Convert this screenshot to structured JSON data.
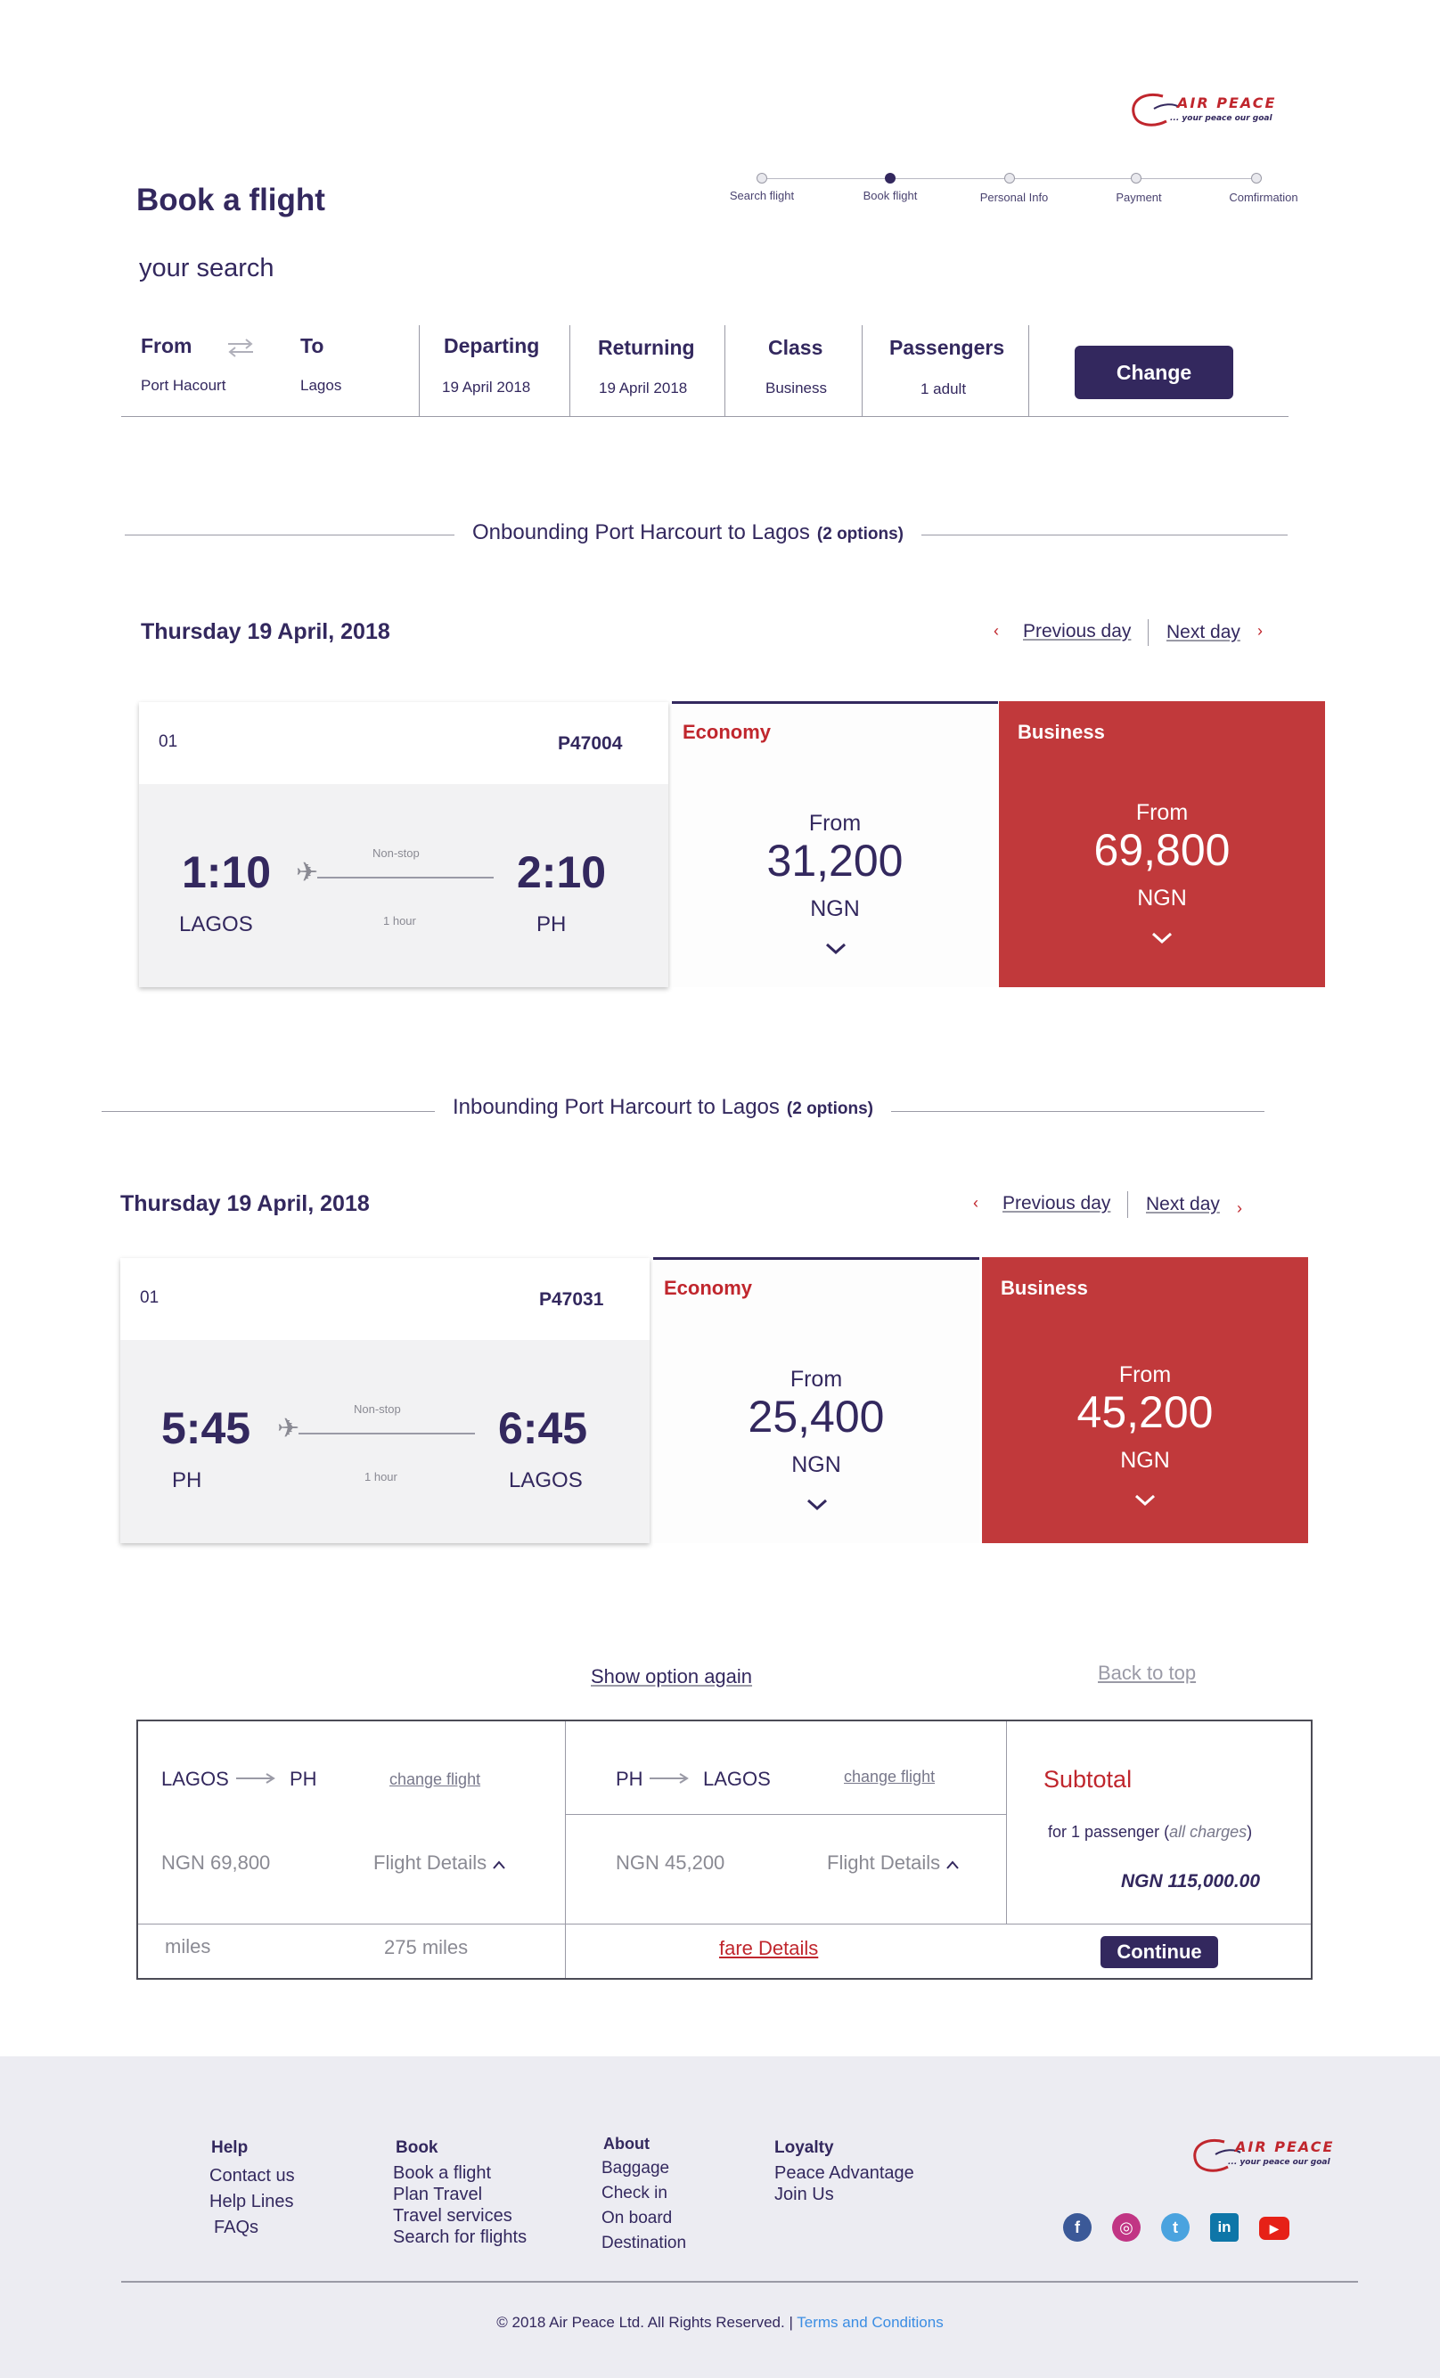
{
  "brand": {
    "name": "AIR PEACE",
    "tagline": "... your peace our goal"
  },
  "header": {
    "title": "Book a flight",
    "subtitle": "your search"
  },
  "stepper": {
    "steps": [
      "Search flight",
      "Book flight",
      "Personal Info",
      "Payment",
      "Comfirmation"
    ],
    "active_index": 1
  },
  "search": {
    "from_label": "From",
    "from_value": "Port Hacourt",
    "to_label": "To",
    "to_value": "Lagos",
    "departing_label": "Departing",
    "departing_value": "19 April 2018",
    "returning_label": "Returning",
    "returning_value": "19 April 2018",
    "class_label": "Class",
    "class_value": "Business",
    "passengers_label": "Passengers",
    "passengers_value": "1 adult",
    "change_label": "Change"
  },
  "onbound": {
    "heading": "Onbounding Port Harcourt to Lagos",
    "options": "(2 options)",
    "date": "Thursday 19 April, 2018",
    "prev_day": "Previous day",
    "next_day": "Next day",
    "flight": {
      "number": "01",
      "code": "P47004",
      "depart_time": "1:10",
      "depart_city": "LAGOS",
      "arrive_time": "2:10",
      "arrive_city": "PH",
      "stops": "Non-stop",
      "duration": "1 hour"
    },
    "economy": {
      "label": "Economy",
      "from": "From",
      "amount": "31,200",
      "currency": "NGN"
    },
    "business": {
      "label": "Business",
      "from": "From",
      "amount": "69,800",
      "currency": "NGN"
    }
  },
  "inbound": {
    "heading": "Inbounding Port Harcourt to Lagos",
    "options": "(2 options)",
    "date": "Thursday 19 April, 2018",
    "prev_day": "Previous day",
    "next_day": "Next day",
    "flight": {
      "number": "01",
      "code": "P47031",
      "depart_time": "5:45",
      "depart_city": "PH",
      "arrive_time": "6:45",
      "arrive_city": "LAGOS",
      "stops": "Non-stop",
      "duration": "1 hour"
    },
    "economy": {
      "label": "Economy",
      "from": "From",
      "amount": "25,400",
      "currency": "NGN"
    },
    "business": {
      "label": "Business",
      "from": "From",
      "amount": "45,200",
      "currency": "NGN"
    }
  },
  "summary": {
    "show_again": "Show option again",
    "back_to_top": "Back to top",
    "leg1": {
      "from": "LAGOS",
      "to": "PH",
      "change": "change flight",
      "price": "NGN 69,800",
      "details": "Flight Details"
    },
    "leg2": {
      "from": "PH",
      "to": "LAGOS",
      "change": "change flight",
      "price": "NGN 45,200",
      "details": "Flight Details"
    },
    "miles_label": "miles",
    "miles_value": "275 miles",
    "fare_details": "fare Details",
    "subtotal_label": "Subtotal",
    "for_passenger": "for 1 passenger (",
    "all_charges": "all charges",
    "for_passenger_end": ")",
    "total": "NGN 115,000.00",
    "continue_label": "Continue"
  },
  "footer": {
    "help": {
      "title": "Help",
      "items": [
        "Contact us",
        "Help Lines",
        "FAQs"
      ]
    },
    "book": {
      "title": "Book",
      "items": [
        "Book a flight",
        "Plan Travel",
        "Travel services",
        "Search for flights"
      ]
    },
    "about": {
      "title": "About",
      "items": [
        "Baggage",
        "Check in",
        "On board",
        "Destination"
      ]
    },
    "loyalty": {
      "title": "Loyalty",
      "items": [
        "Peace Advantage",
        "Join Us"
      ]
    },
    "social": [
      {
        "name": "facebook-icon",
        "glyph": "f",
        "color": "#3b5998"
      },
      {
        "name": "instagram-icon",
        "glyph": "◎",
        "color": "#c13584"
      },
      {
        "name": "twitter-icon",
        "glyph": "t",
        "color": "#4aa3df"
      },
      {
        "name": "linkedin-icon",
        "glyph": "in",
        "color": "#0e76a8"
      },
      {
        "name": "youtube-icon",
        "glyph": "▶",
        "color": "#e62117"
      }
    ],
    "copyright": "© 2018 Air Peace Ltd. All Rights Reserved. |",
    "terms": "Terms and Conditions"
  },
  "colors": {
    "brand_navy": "#33285e",
    "brand_red": "#c0262d",
    "business_bg": "#c1393b",
    "link_blue": "#3b8de3"
  }
}
